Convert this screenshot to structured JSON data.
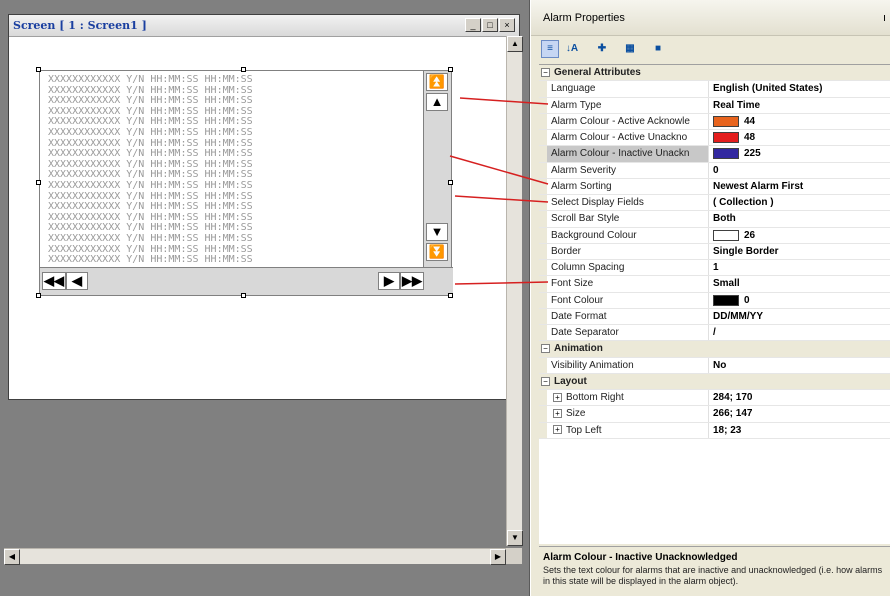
{
  "screen_window": {
    "title": "Screen [ 1 : Screen1 ]",
    "controls": {
      "minimize": "_",
      "restore": "□",
      "close": "×"
    }
  },
  "alarm_rows": [
    "XXXXXXXXXXXX Y/N HH:MM:SS HH:MM:SS",
    "XXXXXXXXXXXX Y/N HH:MM:SS HH:MM:SS",
    "XXXXXXXXXXXX Y/N HH:MM:SS HH:MM:SS",
    "XXXXXXXXXXXX Y/N HH:MM:SS HH:MM:SS",
    "XXXXXXXXXXXX Y/N HH:MM:SS HH:MM:SS",
    "XXXXXXXXXXXX Y/N HH:MM:SS HH:MM:SS",
    "XXXXXXXXXXXX Y/N HH:MM:SS HH:MM:SS",
    "XXXXXXXXXXXX Y/N HH:MM:SS HH:MM:SS",
    "XXXXXXXXXXXX Y/N HH:MM:SS HH:MM:SS",
    "XXXXXXXXXXXX Y/N HH:MM:SS HH:MM:SS",
    "XXXXXXXXXXXX Y/N HH:MM:SS HH:MM:SS",
    "XXXXXXXXXXXX Y/N HH:MM:SS HH:MM:SS",
    "XXXXXXXXXXXX Y/N HH:MM:SS HH:MM:SS",
    "XXXXXXXXXXXX Y/N HH:MM:SS HH:MM:SS",
    "XXXXXXXXXXXX Y/N HH:MM:SS HH:MM:SS",
    "XXXXXXXXXXXX Y/N HH:MM:SS HH:MM:SS",
    "XXXXXXXXXXXX Y/N HH:MM:SS HH:MM:SS",
    "XXXXXXXXXXXX Y/N HH:MM:SS HH:MM:SS"
  ],
  "alarm_scroll": {
    "top": "⏫",
    "up": "▲",
    "down": "▼",
    "bottom": "⏬",
    "first": "◀◀",
    "left": "◀",
    "right": "▶",
    "last": "▶▶"
  },
  "panel": {
    "title": "Alarm Properties",
    "pin": "ı",
    "toolbar": [
      {
        "icon": "categorized-icon",
        "glyph": "≡"
      },
      {
        "icon": "sort-az-icon",
        "glyph": "↓A"
      },
      {
        "icon": "expand-icon",
        "glyph": "✚"
      },
      {
        "icon": "properties-icon",
        "glyph": "▦"
      },
      {
        "icon": "events-icon",
        "glyph": "■"
      }
    ]
  },
  "categories": {
    "general": "General Attributes",
    "animation": "Animation",
    "layout": "Layout"
  },
  "properties": {
    "language": {
      "name": "Language",
      "value": "English (United States)"
    },
    "alarm_type": {
      "name": "Alarm Type",
      "value": "Real Time"
    },
    "colour_active_ack": {
      "name": "Alarm Colour - Active Acknowle",
      "value": "44",
      "color": "#e8641e"
    },
    "colour_active_unack": {
      "name": "Alarm Colour - Active Unackno",
      "value": "48",
      "color": "#e41e1e"
    },
    "colour_inactive_unack": {
      "name": "Alarm Colour - Inactive Unackn",
      "value": "225",
      "color": "#3228a0"
    },
    "alarm_severity": {
      "name": "Alarm Severity",
      "value": "0"
    },
    "alarm_sorting": {
      "name": "Alarm Sorting",
      "value": "Newest Alarm First"
    },
    "display_fields": {
      "name": "Select Display Fields",
      "value": "( Collection )"
    },
    "scroll_bar_style": {
      "name": "Scroll Bar Style",
      "value": "Both"
    },
    "background_colour": {
      "name": "Background Colour",
      "value": "26",
      "color": "#ffffff"
    },
    "border": {
      "name": "Border",
      "value": "Single Border"
    },
    "column_spacing": {
      "name": "Column Spacing",
      "value": "1"
    },
    "font_size": {
      "name": "Font Size",
      "value": "Small"
    },
    "font_colour": {
      "name": "Font Colour",
      "value": "0",
      "color": "#000000"
    },
    "date_format": {
      "name": "Date Format",
      "value": "DD/MM/YY"
    },
    "date_separator": {
      "name": "Date Separator",
      "value": "/"
    },
    "visibility_animation": {
      "name": "Visibility Animation",
      "value": "No"
    },
    "bottom_right": {
      "name": "Bottom Right",
      "value": "284; 170"
    },
    "size": {
      "name": "Size",
      "value": "266; 147"
    },
    "top_left": {
      "name": "Top Left",
      "value": "18; 23"
    }
  },
  "help": {
    "title": "Alarm Colour - Inactive Unacknowledged",
    "text": "Sets the text colour for alarms that are inactive and unacknowledged (i.e. how alarms in this state will be displayed in the alarm object)."
  },
  "callout_color": "#d62020"
}
